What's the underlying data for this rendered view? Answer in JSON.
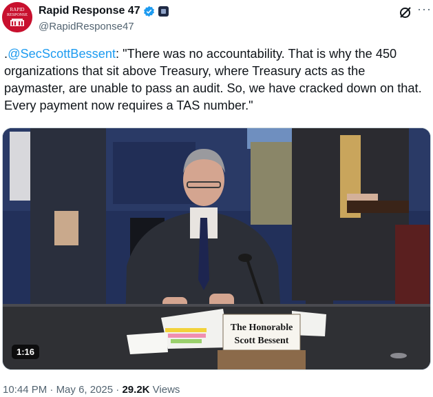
{
  "author": {
    "display_name": "Rapid Response 47",
    "handle": "@RapidResponse47",
    "avatar_text": [
      "RAPID",
      "RESPONSE"
    ],
    "brand_color": "#c8102e"
  },
  "icons": {
    "verified": "verified-badge-icon",
    "affiliation": "government-affiliation-icon",
    "grok": "grok-icon",
    "more": "more-options-icon"
  },
  "tweet": {
    "prefix": ".",
    "mention": "@SecScottBessent",
    "body": ": \"There was no accountability. That is why the 450 organizations that sit above Treasury, where Treasury acts as the paymaster, are unable to pass an audit. So, we have cracked down on that. Every payment now requires a TAS number.\""
  },
  "media": {
    "duration": "1:16",
    "nameplate_line1": "The Honorable",
    "nameplate_line2": "Scott Bessent"
  },
  "meta": {
    "time": "10:44 PM",
    "separator": " · ",
    "date": "May 6, 2025",
    "views_count": "29.2K",
    "views_label": " Views"
  },
  "colors": {
    "link": "#1d9bf0",
    "secondary_text": "#536471",
    "verified": "#1d9bf0"
  }
}
